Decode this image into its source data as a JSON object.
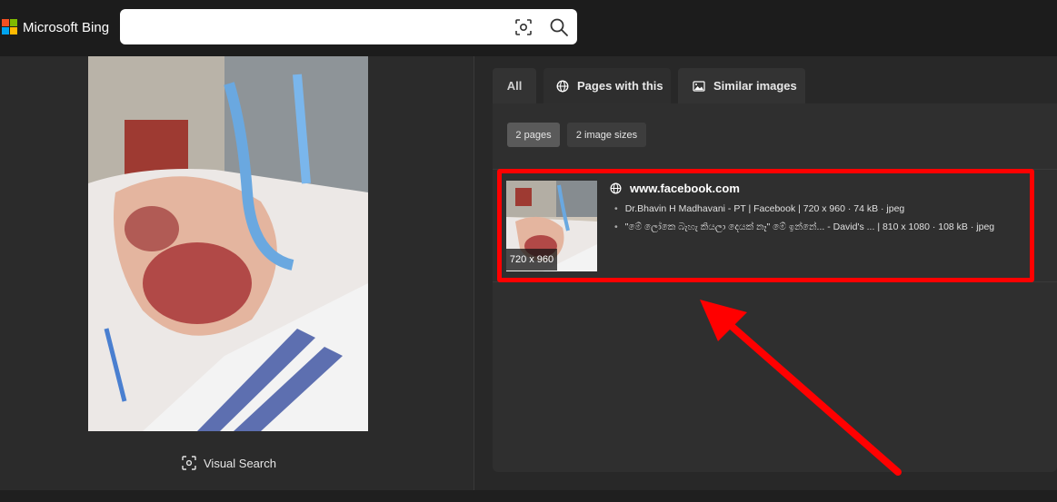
{
  "header": {
    "brand": "Microsoft Bing",
    "search": {
      "value": "",
      "placeholder": ""
    },
    "icons": [
      "visual-search-icon",
      "search-icon"
    ]
  },
  "left": {
    "visual_search_label": "Visual Search"
  },
  "tabs": [
    {
      "label": "All",
      "icon": ""
    },
    {
      "label": "Pages with this",
      "icon": "globe-icon",
      "active": true
    },
    {
      "label": "Similar images",
      "icon": "image-icon"
    }
  ],
  "filters": [
    {
      "label": "2 pages",
      "selected": true
    },
    {
      "label": "2 image sizes",
      "selected": false
    }
  ],
  "result": {
    "thumbnail_size": "720 x 960",
    "site": "www.facebook.com",
    "entries": [
      "Dr.Bhavin H Madhavani - PT | Facebook | 720 x 960 · 74 kB · jpeg",
      "\"මේ ලෝකෙ බැහැ කියලා දෙයක් නෑ\" මේ ඉන්නේ... - David's ... | 810 x 1080 · 108 kB · jpeg"
    ]
  },
  "colors": {
    "highlight": "#ff0000",
    "ms_red": "#f25022",
    "ms_green": "#7fba00",
    "ms_blue": "#00a4ef",
    "ms_yellow": "#ffb900"
  }
}
